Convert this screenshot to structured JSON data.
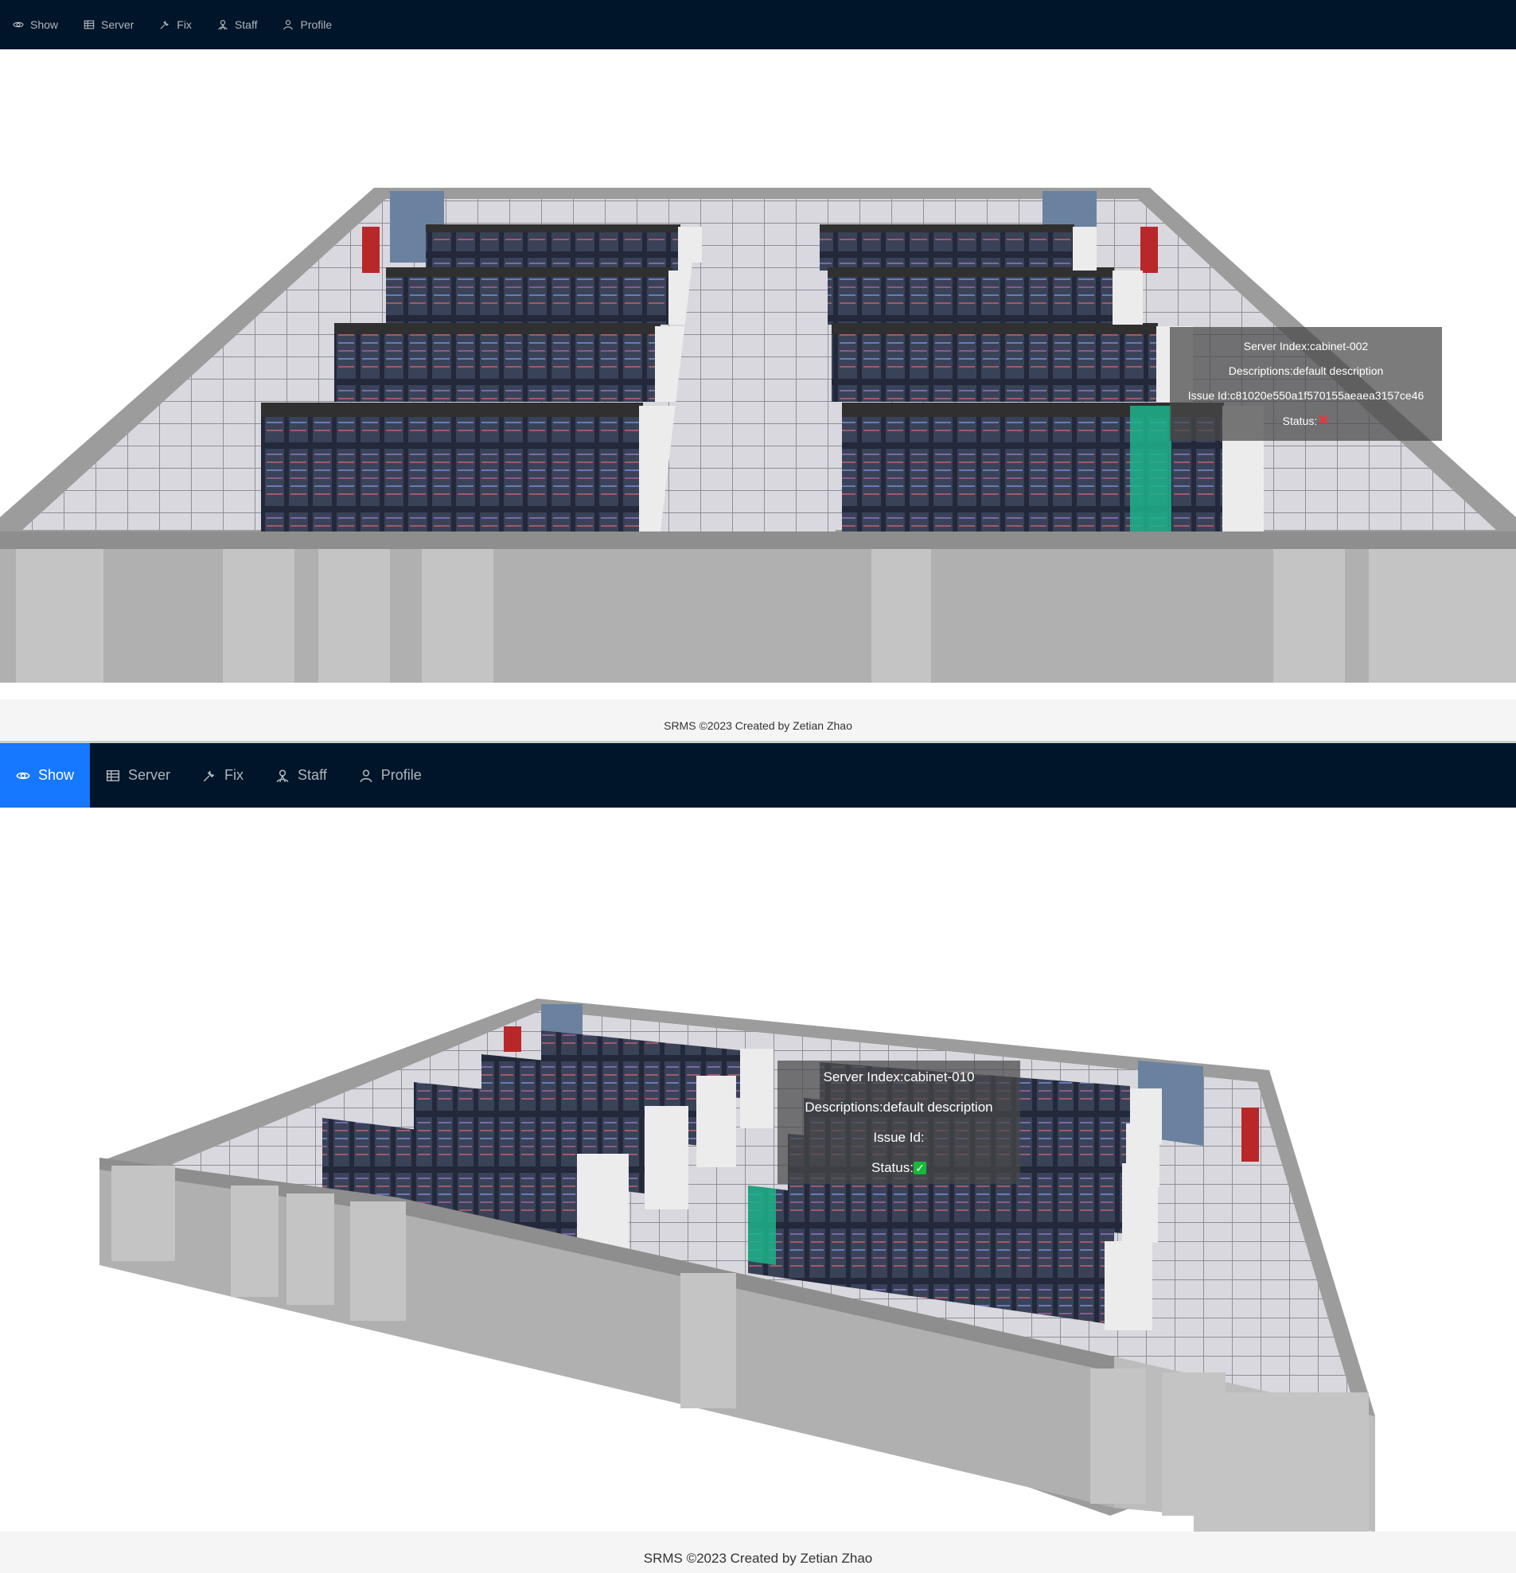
{
  "nav": {
    "items": [
      {
        "label": "Show",
        "icon": "eye-icon"
      },
      {
        "label": "Server",
        "icon": "table-icon"
      },
      {
        "label": "Fix",
        "icon": "wrench-icon"
      },
      {
        "label": "Staff",
        "icon": "staff-icon"
      },
      {
        "label": "Profile",
        "icon": "user-icon"
      }
    ],
    "active_index_second_view": 0,
    "active_color": "#1677ff",
    "bar_color": "#001529"
  },
  "views": [
    {
      "tooltip": {
        "server_index": "Server Index:cabinet-002",
        "descriptions": "Descriptions:default description",
        "issue_id": "Issue Id:c81020e550a1f570155aeaea3157ce46",
        "status_label": "Status:",
        "status_icon": "✕",
        "status_meaning": "error"
      }
    },
    {
      "tooltip": {
        "server_index": "Server Index:cabinet-010",
        "descriptions": "Descriptions:default description",
        "issue_id": "Issue Id:",
        "status_label": "Status:",
        "status_icon": "✓",
        "status_meaning": "ok"
      }
    }
  ],
  "footer": {
    "text": "SRMS ©2023 Created by Zetian Zhao"
  },
  "colors": {
    "highlight_cabinet": "#1db38a",
    "status_error": "#ff2d2d",
    "status_ok": "#18b83a"
  }
}
